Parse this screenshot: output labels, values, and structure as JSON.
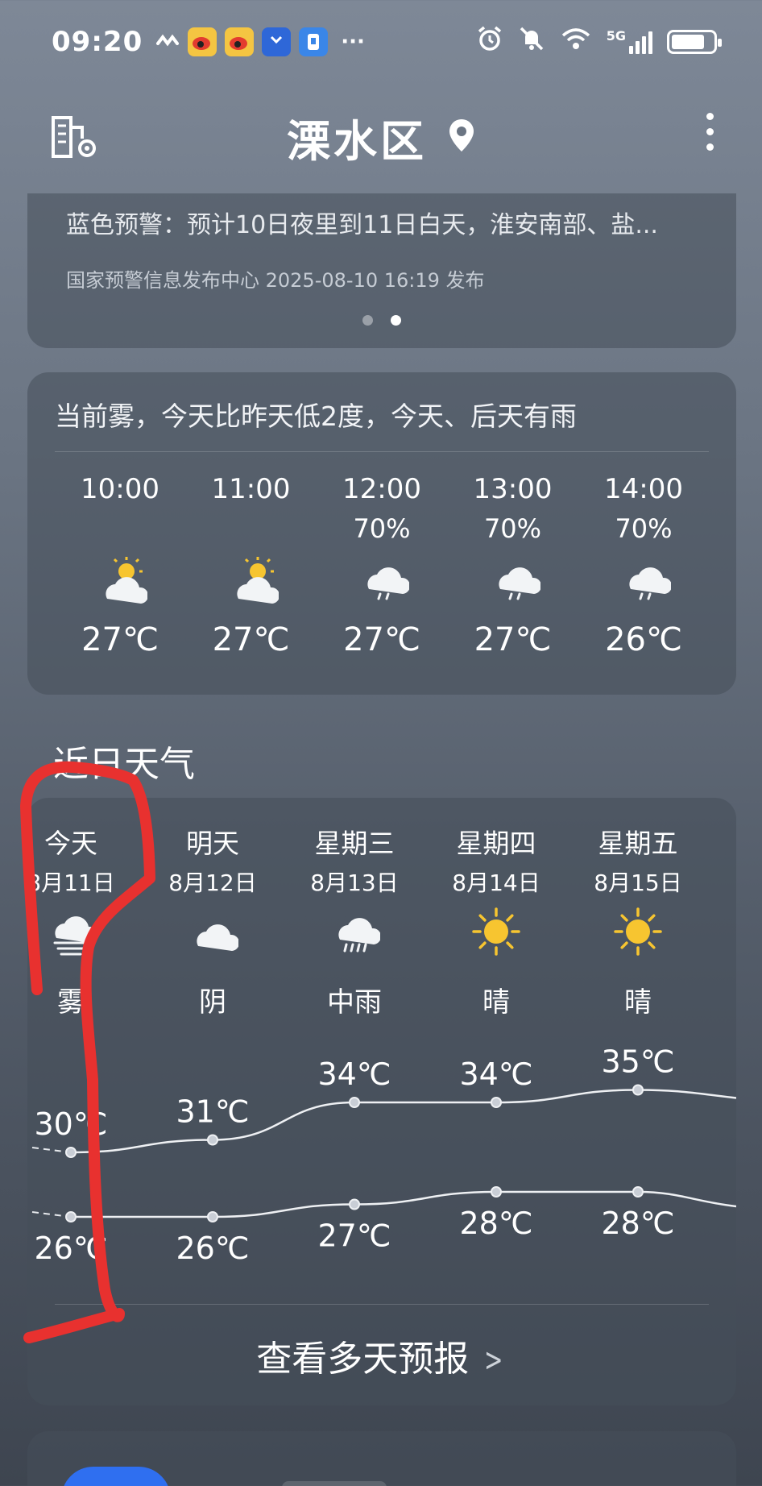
{
  "status_bar": {
    "time": "09:20",
    "more": "···",
    "network": "5G"
  },
  "header": {
    "city": "溧水区"
  },
  "alert": {
    "text": "蓝色预警：预计10日夜里到11日白天，淮安南部、盐...",
    "source": "国家预警信息发布中心 2025-08-10 16:19 发布",
    "page_count": 2,
    "active_page": 2
  },
  "hourly": {
    "summary": "当前雾，今天比昨天低2度，今天、后天有雨",
    "items": [
      {
        "time": "10:00",
        "precip": "",
        "icon": "partly-cloudy-icon",
        "temp": "27℃"
      },
      {
        "time": "11:00",
        "precip": "",
        "icon": "partly-cloudy-icon",
        "temp": "27℃"
      },
      {
        "time": "12:00",
        "precip": "70%",
        "icon": "light-rain-icon",
        "temp": "27℃"
      },
      {
        "time": "13:00",
        "precip": "70%",
        "icon": "light-rain-icon",
        "temp": "27℃"
      },
      {
        "time": "14:00",
        "precip": "70%",
        "icon": "light-rain-icon",
        "temp": "26℃"
      }
    ]
  },
  "daily": {
    "title": "近日天气",
    "items": [
      {
        "name": "今天",
        "date": "8月11日",
        "icon": "fog-icon",
        "condition": "雾",
        "high": 30,
        "low": 26,
        "high_label": "30℃",
        "low_label": "26℃"
      },
      {
        "name": "明天",
        "date": "8月12日",
        "icon": "cloudy-icon",
        "condition": "阴",
        "high": 31,
        "low": 26,
        "high_label": "31℃",
        "low_label": "26℃"
      },
      {
        "name": "星期三",
        "date": "8月13日",
        "icon": "moderate-rain-icon",
        "condition": "中雨",
        "high": 34,
        "low": 27,
        "high_label": "34℃",
        "low_label": "27℃"
      },
      {
        "name": "星期四",
        "date": "8月14日",
        "icon": "sunny-icon",
        "condition": "晴",
        "high": 34,
        "low": 28,
        "high_label": "34℃",
        "low_label": "28℃"
      },
      {
        "name": "星期五",
        "date": "8月15日",
        "icon": "sunny-icon",
        "condition": "晴",
        "high": 35,
        "low": 28,
        "high_label": "35℃",
        "low_label": "28℃"
      }
    ],
    "more_label": "查看多天预报"
  },
  "colors": {
    "accent_blue": "#2f6ff0",
    "annotation_red": "#e8312f",
    "sun": "#f7c530"
  }
}
